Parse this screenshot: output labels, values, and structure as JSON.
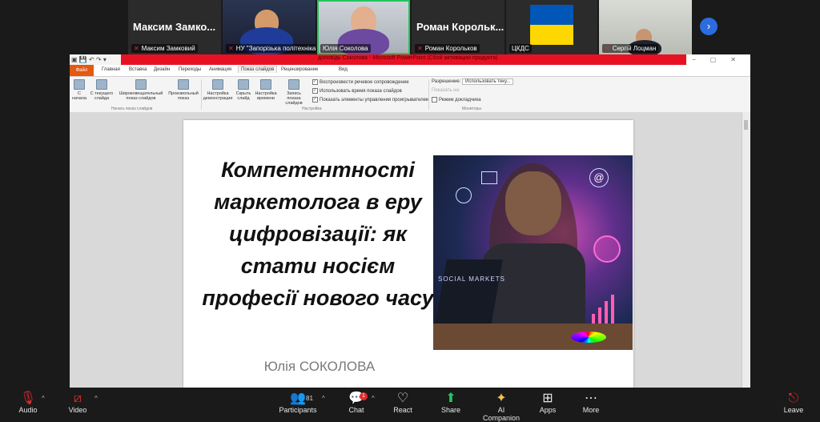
{
  "participants": [
    {
      "big_name": "Максим Замко...",
      "caption": "Максим Замковий",
      "muted": true
    },
    {
      "big_name": "",
      "caption": "НУ \"Запорізька політехніка\"",
      "muted": true
    },
    {
      "big_name": "",
      "caption": "Юлія Соколова",
      "muted": false
    },
    {
      "big_name": "Роман Корольк...",
      "caption": "Роман Корольков",
      "muted": true
    },
    {
      "big_name": "",
      "caption": "ЦКДС",
      "muted": false
    },
    {
      "big_name": "",
      "caption": "Сергій Лоцман",
      "muted": true
    }
  ],
  "powerpoint": {
    "window_title": "доповідь Соколова - Microsoft PowerPoint (Сбой активации продукта)",
    "tabs": [
      "Файл",
      "Главная",
      "Вставка",
      "Дизайн",
      "Переходы",
      "Анимация",
      "Показ слайдов",
      "Рецензирование",
      "Вид"
    ],
    "active_tab": "Показ слайдов",
    "ribbon": {
      "btn_from_start": "С начала",
      "btn_from_current": "С текущего слайда",
      "btn_broadcast": "Широковещательный показ слайдов",
      "btn_custom": "Произвольный показ",
      "group_start": "Начать показ слайдов",
      "btn_setup": "Настройка демонстрации",
      "btn_hide": "Скрыть слайд",
      "btn_rehearse": "Настройка времени",
      "btn_record": "Запись показа слайдов",
      "chk_narration": "Воспроизвести речевое сопровождение",
      "chk_timings": "Использовать время показа слайдов",
      "chk_controls": "Показать элементы управления проигрывателем",
      "group_setup": "Настройка",
      "resolution_label": "Разрешение:",
      "resolution_value": "Использовать теку...",
      "show_on_label": "Показать на:",
      "presenter_view": "Режим докладчика",
      "group_monitors": "Мониторы"
    },
    "slide": {
      "title": "Компетентності маркетолога в еру цифровізації: як стати носієм професії нового часу",
      "author": "Юлія СОКОЛОВА",
      "image_text": "SOCIAL MARKETS"
    }
  },
  "toolbar": {
    "audio": "Audio",
    "video": "Video",
    "participants": "Participants",
    "participants_count": "81",
    "chat": "Chat",
    "chat_badge": "1",
    "react": "React",
    "share": "Share",
    "ai": "AI Companion",
    "apps": "Apps",
    "more": "More",
    "leave": "Leave"
  },
  "colors": {
    "accent_red": "#e81123",
    "zoom_green": "#22c55e",
    "ppt_orange": "#e35a10",
    "nav_blue": "#2d6cdf"
  }
}
